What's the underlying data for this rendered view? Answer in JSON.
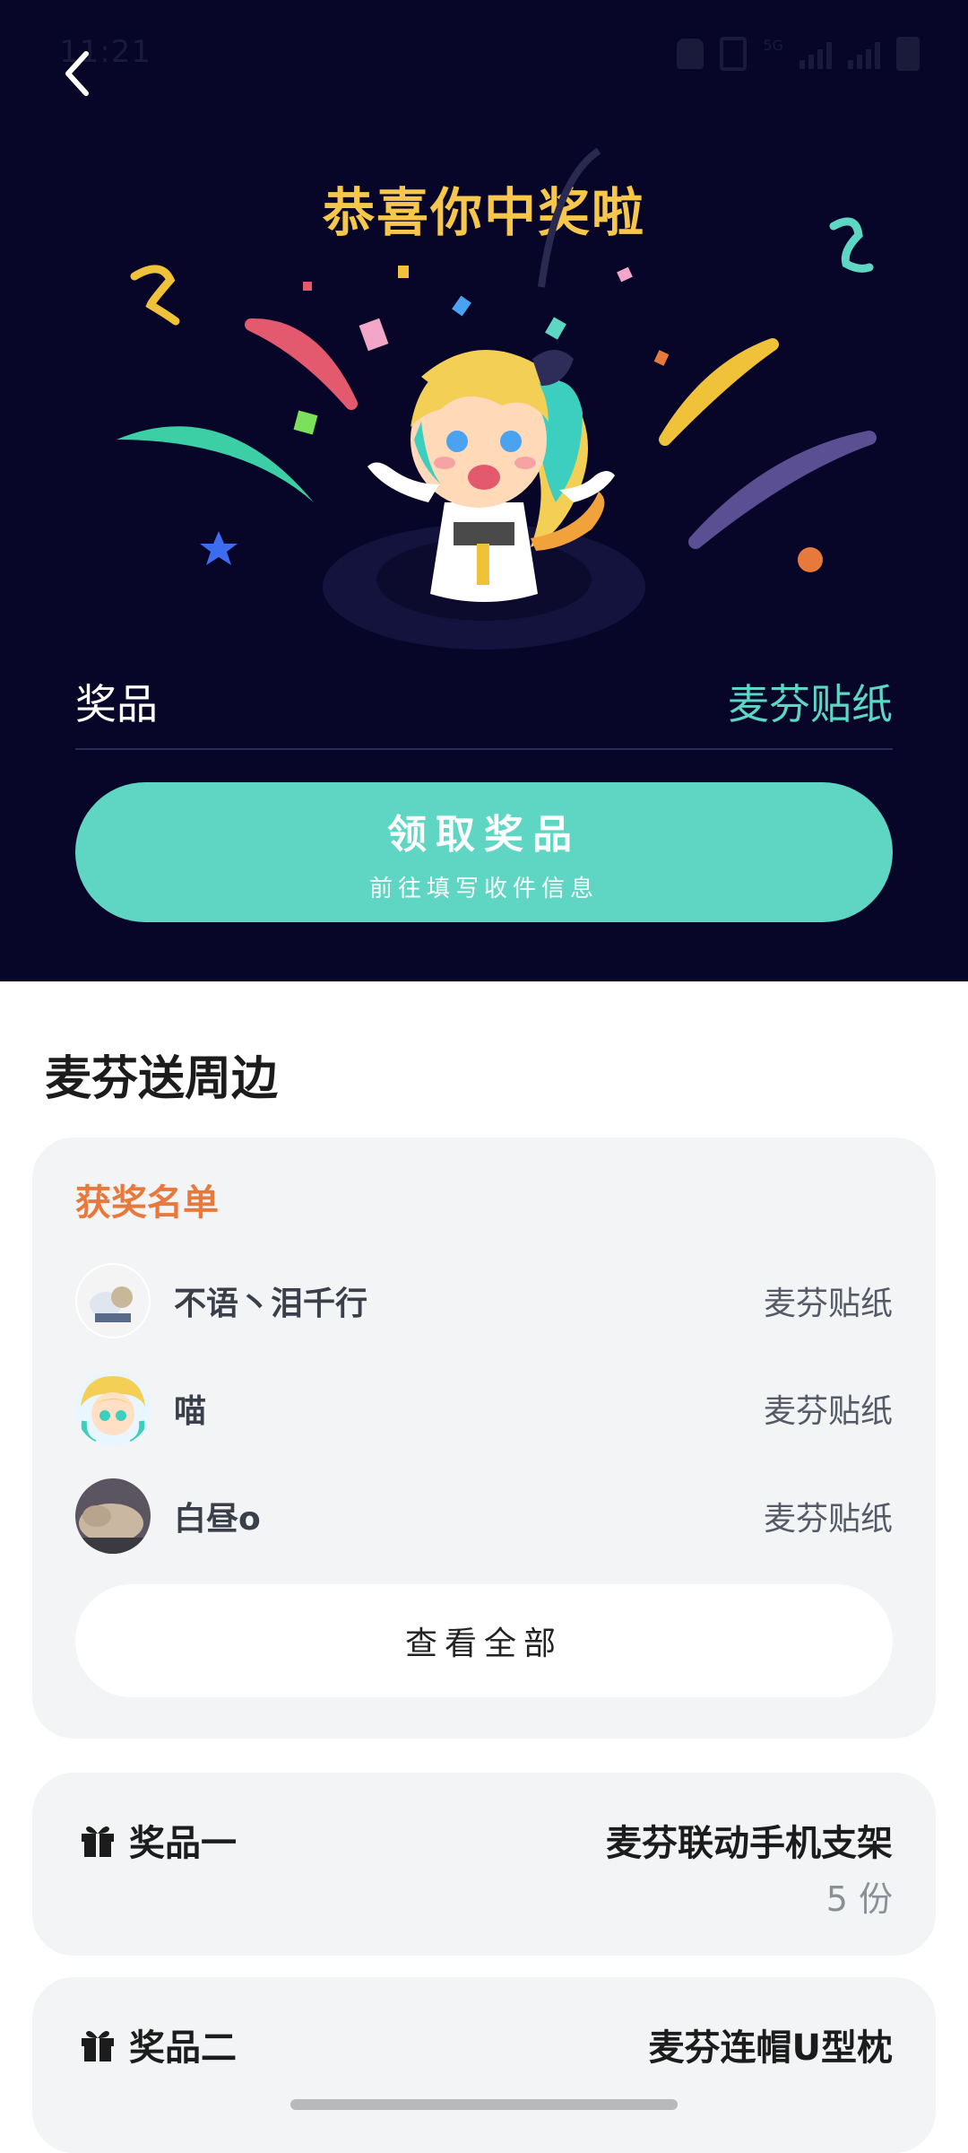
{
  "status_bar": {
    "time": "11:21",
    "network": "5G"
  },
  "hero": {
    "title": "恭喜你中奖啦",
    "prize_label": "奖品",
    "prize_value": "麦芬贴纸",
    "claim_button": {
      "title": "领取奖品",
      "subtitle": "前往填写收件信息"
    }
  },
  "section": {
    "title": "麦芬送周边"
  },
  "winners": {
    "heading": "获奖名单",
    "items": [
      {
        "name": "不语丶泪千行",
        "prize": "麦芬贴纸"
      },
      {
        "name": "喵",
        "prize": "麦芬贴纸"
      },
      {
        "name": "白昼o",
        "prize": "麦芬贴纸"
      }
    ],
    "view_all": "查看全部"
  },
  "prizes": [
    {
      "label": "奖品一",
      "name": "麦芬联动手机支架",
      "count": "5 份"
    },
    {
      "label": "奖品二",
      "name": "麦芬连帽U型枕"
    }
  ],
  "colors": {
    "hero_bg": "#070628",
    "title_gold": "#f6c74a",
    "accent_teal": "#5fd5c3",
    "winners_heading": "#e8793d",
    "card_bg": "#f3f4f6"
  }
}
